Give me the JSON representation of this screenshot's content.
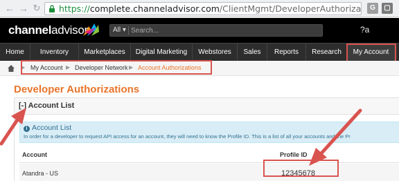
{
  "browser": {
    "url_protocol": "https://",
    "url_host": "complete.channeladvisor.com",
    "url_path": "/ClientMgmt/DeveloperAuthorizations.mvc/?a",
    "ext1": "G",
    "back_icon": "back-arrow-icon",
    "forward_icon": "forward-arrow-icon",
    "lock_icon": "lock-icon",
    "star_icon": "star-icon"
  },
  "header": {
    "logo_part1": "channel",
    "logo_part2": "advisor",
    "search_scope": "All ▾",
    "search_placeholder": "Search...",
    "right_text": "?a"
  },
  "nav": {
    "items": [
      "Home",
      "Inventory",
      "Marketplaces",
      "Digital Marketing",
      "Webstores",
      "Sales",
      "Reports",
      "Research",
      "My Account"
    ],
    "active_index": 8
  },
  "breadcrumb": {
    "items": [
      "My Account",
      "Developer Network",
      "Account Authorizations"
    ]
  },
  "page": {
    "title": "Developer Authorizations",
    "panel_toggle": "[-]",
    "panel_title": "Account List",
    "info_title": "Account List",
    "info_text": "In order for a developer to request API access for an account, they will need to know the Profile ID. This is a list of all your accounts and the Pr",
    "table": {
      "headers": [
        "Account",
        "Profile ID"
      ],
      "rows": [
        {
          "account": "Atandra - US",
          "profile_id": "12345678"
        }
      ]
    }
  },
  "colors": {
    "accent_orange": "#e8742a",
    "annotation_red": "#d9534f",
    "info_blue": "#31708f",
    "nav_bg": "#2d2d2d"
  }
}
